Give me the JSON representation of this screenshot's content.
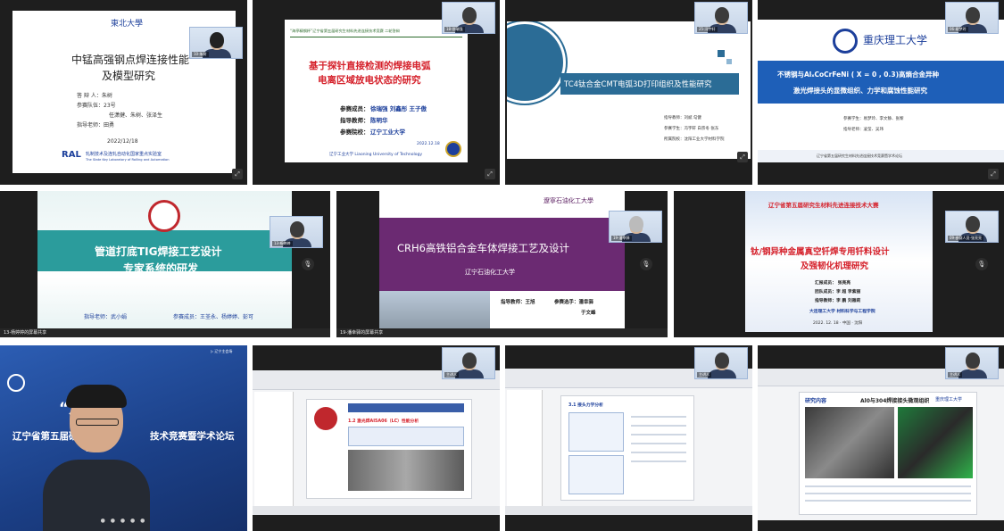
{
  "tiles": {
    "t1": {
      "logo": "東北大學",
      "title_line1": "中锰高强钢点焊连接性能",
      "title_line2": "及模型研究",
      "speaker": "答 辩 人：朱树",
      "team": "参赛队伍：23号",
      "members": "任潇健、朱树、张泽生",
      "advisor": "指导老师：田勇",
      "date": "2022/12/18",
      "lab_cn": "轧制技术及连轧自动化国家重点实验室",
      "lab_en": "The State Key Laboratory of Rolling and Automation",
      "thumb_label": "10-朱树"
    },
    "t2": {
      "header": "“海亭精钢杯”辽宁省第五届研究生材料先进连接技术竞赛  二轮答辩",
      "title_line1": "基于探针直接检测的焊接电弧",
      "title_line2": "电离区域放电状态的研究",
      "members_label": "参赛成员：",
      "members": "徐瑞强 刘鑫彤 王子傲",
      "advisor_label": "指导教师：",
      "advisor": "陈明华",
      "school_label": "参赛院校：",
      "school": "辽宁工业大学",
      "date": "2022.12.18",
      "footer": "辽宁工业大学  Liaoning University of Technology",
      "thumb_label": "18-徐瑞强"
    },
    "t3": {
      "title": "TC4钛合金CMT电弧3D打印组织及性能研究",
      "advisor": "指导教师：刘斌 勾健",
      "students": "参赛学生：冯宇轩 白宗冬 张东",
      "school": "所属院校：沈阳工业大学材料学院",
      "thumb_label": "25-冯宇轩"
    },
    "t4": {
      "school": "重庆理工大学",
      "title_line1": "不锈钢与AlₓCoCrFeNi ( X = 0 , 0.3)高熵合金异种",
      "title_line2": "激光焊接头的显微组织、力学和腐蚀性能研究",
      "members": "参赛学生：易梦玲、李文静、张黎",
      "advisor": "指导老师：凌莹、吴玮",
      "footer": "辽宁省第五届研究生材料先进连接技术竞赛暨学术论坛",
      "thumb_label": "06-易梦玲"
    },
    "t5": {
      "title_line1": "管道打底TIG焊接工艺设计",
      "title_line2": "专家系统的研发",
      "advisor": "指导老师：武小娟",
      "members": "参赛成员：王荃永、杨婷婷、彭可",
      "thumb_label": "13-杨婷婷",
      "bar_label": "13-杨婷婷的屏幕共享"
    },
    "t6": {
      "school_cn": "遼寧石油化工大學",
      "title": "CRH6高铁铝合金车体焊接工艺及设计",
      "school": "辽宁石油化工大学",
      "advisor": "指导教师：王旭",
      "members": "参赛选手：潘幸驿",
      "members2": "于文峰",
      "thumb_label": "19-潘幸驿",
      "bar_label": "19-潘幸驿的屏幕共享"
    },
    "t7": {
      "banner": "辽宁省第五届研究生材料先进连接技术大赛",
      "title_line1": "钛/钢异种金属真空钎焊专用钎料设计",
      "title_line2": "及强韧化机理研究",
      "reporter": "汇报成员：  张亮亮",
      "team": "团队成员：李  超    李紫丽",
      "advisor": "指导教师：李  鹏 刘雅莉",
      "school": "大连理工大学 材料科学与工程学院",
      "date": "2022. 12. 18   ·   中国 · 沈阳",
      "thumb_label": "09-参赛人员-张亮亮"
    },
    "t8": {
      "slogan": "“双     杯”",
      "line1": "辽宁省第五届研究生",
      "line1b": "技术竞赛暨学术论坛",
      "year": "20          8",
      "corner": "▷ 辽宁主会场"
    },
    "t9": {
      "heading": "1.2  激光焊AI5A06（LC）性能分析",
      "thumb_label": "主讲人"
    },
    "t10": {
      "heading": "3.1  接头力学分析",
      "thumb_label": "主讲人"
    },
    "t11": {
      "heading": "研究内容",
      "title": "Al0与304焊接接头微观组织",
      "school": "重庆理工大学",
      "thumb_label": "主讲人"
    }
  },
  "colors": {
    "red": "#d5202a",
    "blue": "#1c3f9b",
    "teal": "#2b9c9c",
    "purple": "#6b2a72",
    "dark_bg": "#1e1e1e"
  }
}
